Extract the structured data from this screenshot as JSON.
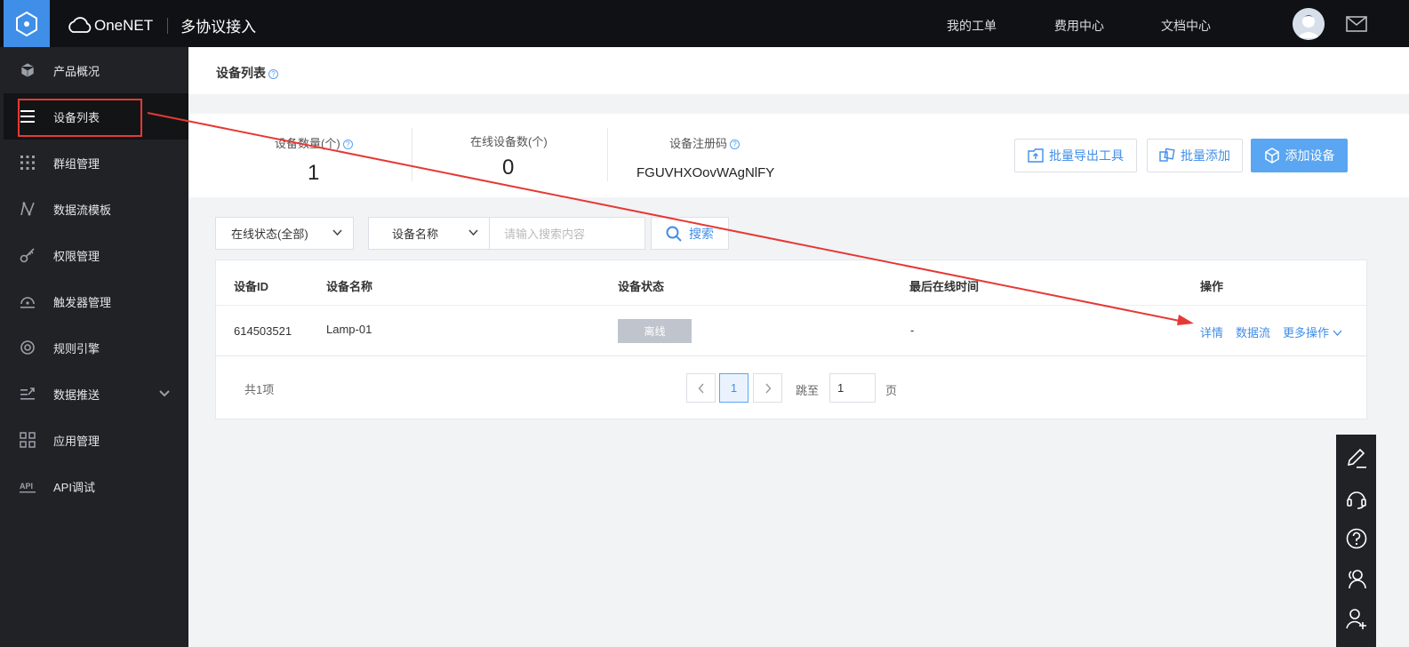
{
  "topbar": {
    "brand": "OneNET",
    "subtitle": "多协议接入",
    "nav": [
      "我的工单",
      "费用中心",
      "文档中心"
    ]
  },
  "sidebar": {
    "items": [
      {
        "label": "产品概况",
        "icon": "cube-icon"
      },
      {
        "label": "设备列表",
        "icon": "list-icon"
      },
      {
        "label": "群组管理",
        "icon": "grid-dots-icon"
      },
      {
        "label": "数据流模板",
        "icon": "curve-icon"
      },
      {
        "label": "权限管理",
        "icon": "key-icon"
      },
      {
        "label": "触发器管理",
        "icon": "trigger-icon"
      },
      {
        "label": "规则引擎",
        "icon": "rule-icon"
      },
      {
        "label": "数据推送",
        "icon": "push-icon"
      },
      {
        "label": "应用管理",
        "icon": "apps-icon"
      },
      {
        "label": "API调试",
        "icon": "api-icon"
      }
    ]
  },
  "page": {
    "title": "设备列表",
    "help": "?"
  },
  "stats": {
    "device_count_label": "设备数量(个)",
    "device_count": "1",
    "online_count_label": "在线设备数(个)",
    "online_count": "0",
    "reg_code_label": "设备注册码",
    "reg_code": "FGUVHXOovWAgNlFY"
  },
  "actions": {
    "export": "批量导出工具",
    "batch_add": "批量添加",
    "add_device": "添加设备"
  },
  "filters": {
    "status": "在线状态(全部)",
    "field": "设备名称",
    "search_placeholder": "请输入搜索内容",
    "search_button": "搜索"
  },
  "table": {
    "columns": [
      "设备ID",
      "设备名称",
      "设备状态",
      "最后在线时间",
      "操作"
    ],
    "rows": [
      {
        "id": "614503521",
        "name": "Lamp-01",
        "status": "离线",
        "last_online": "-",
        "ops": [
          "详情",
          "数据流",
          "更多操作"
        ]
      }
    ]
  },
  "pagination": {
    "total": "共1项",
    "current": "1",
    "jump_label": "跳至",
    "jump_value": "1",
    "page_unit": "页"
  },
  "colors": {
    "accent": "#3f8ee8",
    "sidebar_bg": "#212226",
    "topbar_bg": "#101114",
    "annotation": "#e53935"
  }
}
